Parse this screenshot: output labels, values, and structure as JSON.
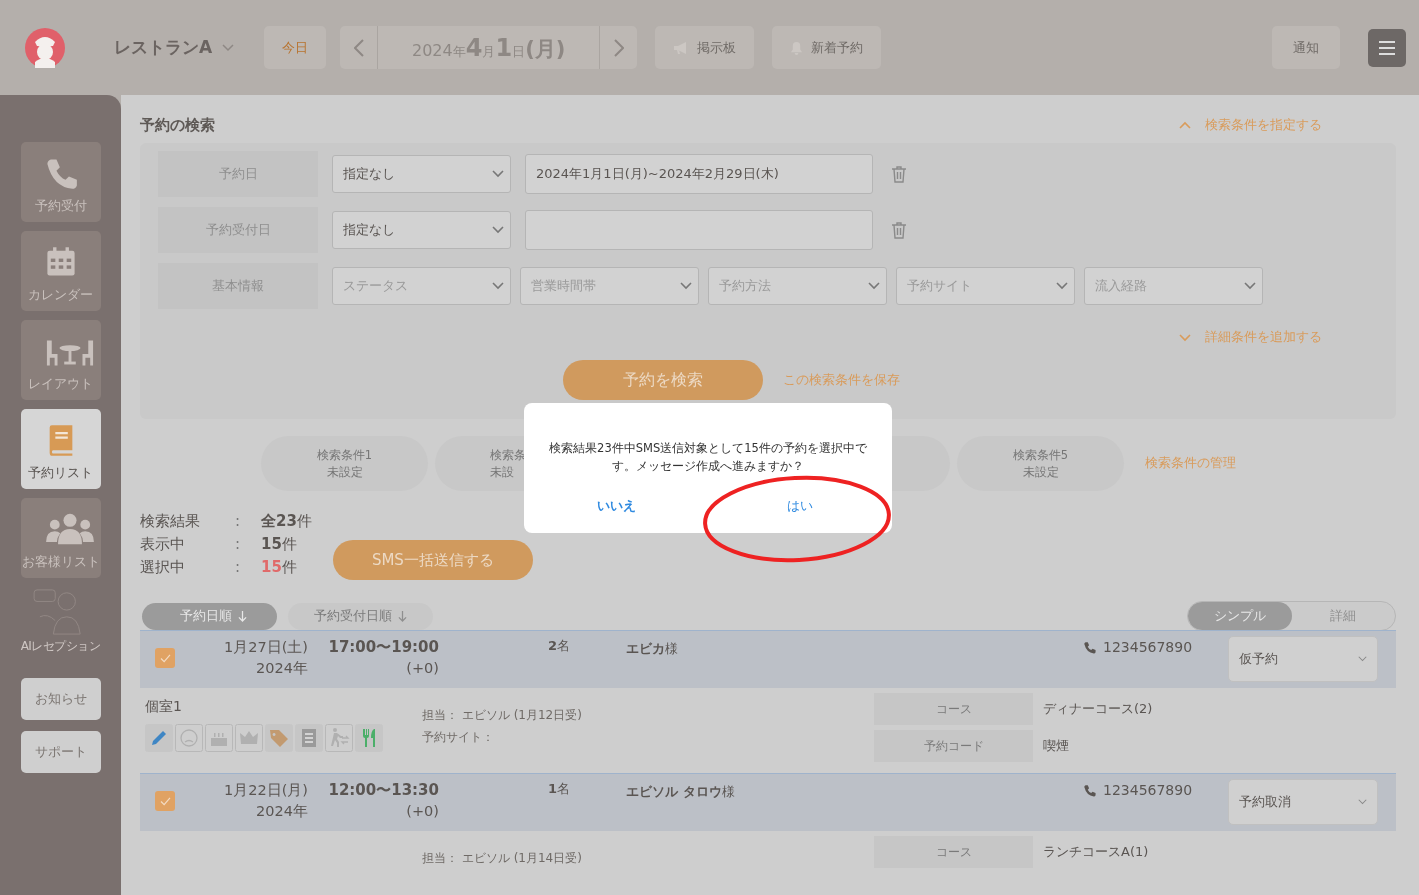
{
  "header": {
    "restaurant": "レストランA",
    "today_button": "今日",
    "date_parts": [
      {
        "text": "2024",
        "kind": "small"
      },
      {
        "text": "年",
        "kind": "unit"
      },
      {
        "text": " 4",
        "kind": "large"
      },
      {
        "text": "月",
        "kind": "unit"
      },
      {
        "text": " 1",
        "kind": "large"
      },
      {
        "text": "日",
        "kind": "unit"
      },
      {
        "text": "(月)",
        "kind": "medium"
      }
    ],
    "board_button": "掲示板",
    "new_reservations_button": "新着予約",
    "notifications_button": "通知"
  },
  "sidebar": {
    "items": [
      {
        "label": "予約受付",
        "kind": "phone",
        "selected": false
      },
      {
        "label": "カレンダー",
        "kind": "calendar",
        "selected": false
      },
      {
        "label": "レイアウト",
        "kind": "table",
        "selected": false
      },
      {
        "label": "予約リスト",
        "kind": "book",
        "selected": true
      },
      {
        "label": "お客様リスト",
        "kind": "people",
        "selected": false
      }
    ],
    "ai_reception": "AIレセプション",
    "buttons": [
      "お知らせ",
      "サポート"
    ]
  },
  "search": {
    "title": "予約の検索",
    "specify_link": "検索条件を指定する",
    "rows": [
      {
        "label": "予約日",
        "select": "指定なし",
        "range": "2024年1月1日(月)~2024年2月29日(木)"
      },
      {
        "label": "予約受付日",
        "select": "指定なし"
      }
    ],
    "basic": {
      "label": "基本情報",
      "placeholders": [
        "ステータス",
        "営業時間帯",
        "予約方法",
        "予約サイト",
        "流入経路"
      ]
    },
    "add_link": "詳細条件を追加する",
    "search_button": "予約を検索",
    "save_link": "この検索条件を保存"
  },
  "saved_searches": {
    "items": [
      {
        "kind": "slot",
        "label": "検索条件1",
        "status": "未設定"
      },
      {
        "kind": "partial",
        "label": "検索条",
        "status": "未設"
      },
      {
        "kind": "covered"
      },
      {
        "kind": "slot",
        "label": "検索条件5",
        "status": "未設定"
      }
    ],
    "manage_link": "検索条件の管理"
  },
  "results": {
    "rows": [
      {
        "label": "検索結果",
        "separator": ":",
        "value": "**全23**件",
        "highlight": false
      },
      {
        "label": "表示中",
        "separator": ":",
        "value": "**15**件",
        "highlight": false
      },
      {
        "label": "選択中",
        "separator": ":",
        "value": "**15**件",
        "highlight": true
      }
    ],
    "sms_button": "SMS一括送信する"
  },
  "sort": {
    "buttons": [
      {
        "label": "予約日順",
        "selected": true
      },
      {
        "label": "予約受付日順",
        "selected": false
      }
    ],
    "view_toggle": [
      {
        "label": "シンプル",
        "selected": true
      },
      {
        "label": "詳細",
        "selected": false
      }
    ]
  },
  "reservations": [
    {
      "checked": true,
      "date": "1月27日(土)",
      "year": "2024年",
      "time": "17:00〜19:00",
      "offset": "(+0)",
      "party": "**2**名",
      "name": "**エビカ**様",
      "phone": "1234567890",
      "status": "仮予約",
      "room": "個室1",
      "staff_label": "担当：",
      "staff": "エビソル (1月12日受)",
      "site_label": "予約サイト：",
      "icons": [
        {
          "kind": "pencil",
          "on": true
        },
        {
          "kind": "face",
          "on": false
        },
        {
          "kind": "cake",
          "on": false
        },
        {
          "kind": "crown",
          "on": false
        },
        {
          "kind": "tag",
          "on": true
        },
        {
          "kind": "memo",
          "on": true
        },
        {
          "kind": "walk",
          "on": false
        },
        {
          "kind": "utensils",
          "on": true
        }
      ],
      "details": [
        {
          "label": "コース",
          "value": "ディナーコース(2)"
        },
        {
          "label": "予約コード",
          "value": "喫煙"
        }
      ]
    },
    {
      "checked": true,
      "date": "1月22日(月)",
      "year": "2024年",
      "time": "12:00〜13:30",
      "offset": "(+0)",
      "party": "**1**名",
      "name": "**エビソル タロウ**様",
      "phone": "1234567890",
      "status": "予約取消",
      "staff_label": "担当：",
      "staff": "エビソル (1月14日受)",
      "details": [
        {
          "label": "コース",
          "value": "ランチコースA(1)"
        }
      ]
    }
  ],
  "dialog": {
    "message": "検索結果23件中SMS送信対象として15件の予約を選択中です。メッセージ作成へ進みますか？",
    "no_button": "いいえ",
    "yes_button": "はい",
    "yes_circled": true
  }
}
